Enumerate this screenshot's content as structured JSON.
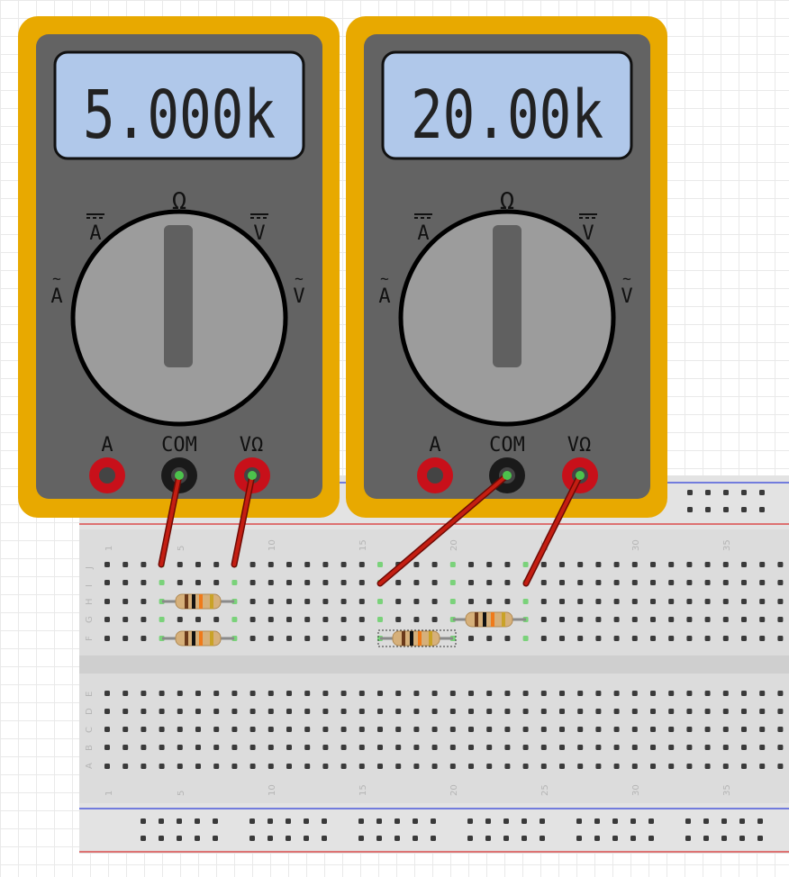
{
  "meters": [
    {
      "reading": "5.000k",
      "dial_labels": {
        "ohm": "Ω",
        "dc_amps": "A",
        "dc_volts": "V",
        "ac_amps": "A",
        "ac_volts": "V"
      },
      "jack_labels": {
        "amps": "A",
        "common": "COM",
        "volt_ohm": "VΩ"
      }
    },
    {
      "reading": "20.00k",
      "dial_labels": {
        "ohm": "Ω",
        "dc_amps": "A",
        "dc_volts": "V",
        "ac_amps": "A",
        "ac_volts": "V"
      },
      "jack_labels": {
        "amps": "A",
        "common": "COM",
        "volt_ohm": "VΩ"
      }
    }
  ],
  "breadboard": {
    "row_labels_top": [
      "J",
      "I",
      "H",
      "G",
      "F"
    ],
    "row_labels_bottom": [
      "E",
      "D",
      "C",
      "B",
      "A"
    ],
    "column_numbers": [
      "1",
      "5",
      "10",
      "15",
      "20",
      "25",
      "30",
      "35"
    ]
  },
  "colors": {
    "meter_case": "#e8a900",
    "meter_face": "#636363",
    "lcd": "#b0c8ea",
    "probe_wire": "#b51c10",
    "jack": "#c8101a",
    "breadboard": "#dcdcdc",
    "rail_red": "#d92f2f",
    "rail_blue": "#2f3fd9",
    "active_hole": "#7ad27a"
  },
  "components": {
    "resistor_count": 4,
    "resistor_bands": [
      "brown",
      "black",
      "orange",
      "gold"
    ]
  }
}
